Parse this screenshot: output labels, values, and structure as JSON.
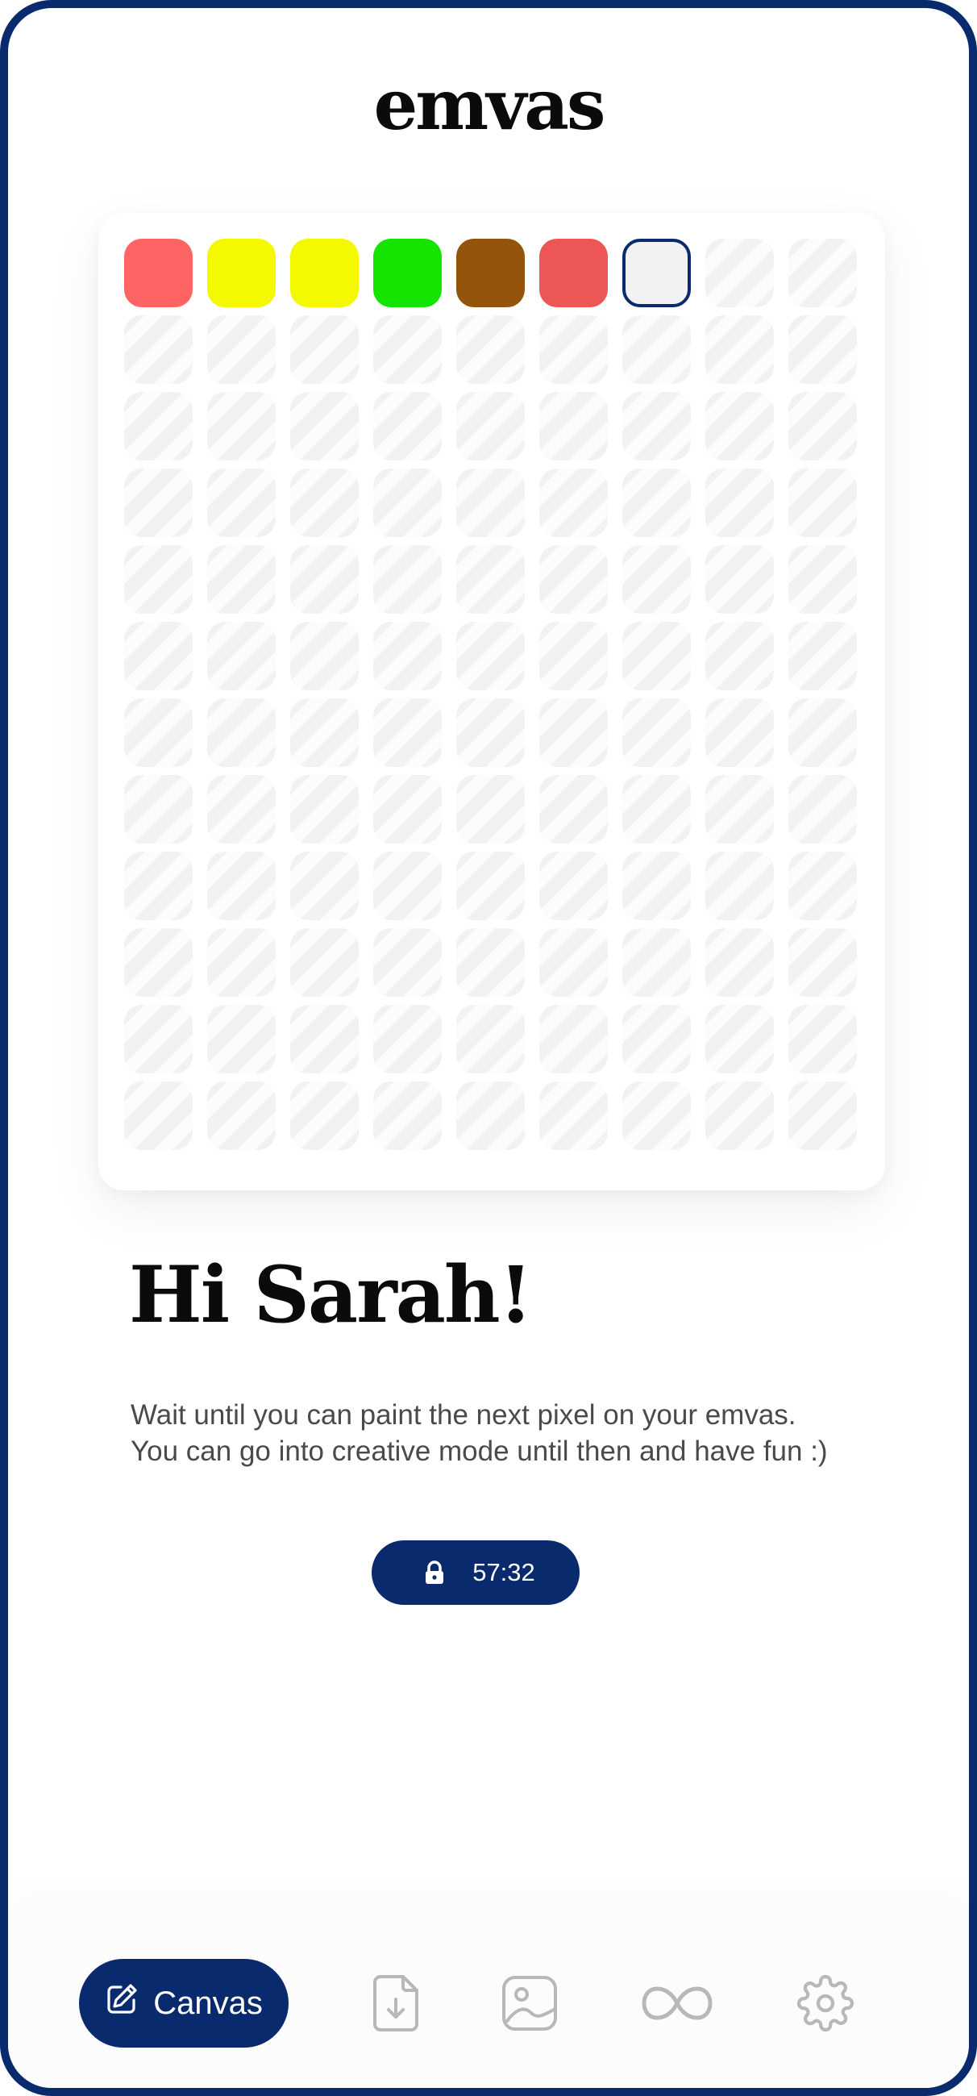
{
  "app": {
    "logo_text": "emvas"
  },
  "canvas": {
    "columns": 9,
    "rows": 12,
    "painted": [
      {
        "index": 0,
        "color": "#ff6464"
      },
      {
        "index": 1,
        "color": "#f4f900"
      },
      {
        "index": 2,
        "color": "#f4f900"
      },
      {
        "index": 3,
        "color": "#14e400"
      },
      {
        "index": 4,
        "color": "#95540c"
      },
      {
        "index": 5,
        "color": "#ec5656"
      }
    ],
    "selected_index": 6
  },
  "greeting": {
    "title": "Hi Sarah!",
    "message_line1": "Wait until you can paint the next pixel on your emvas.",
    "message_line2": "You can go into creative mode until then and have fun :)"
  },
  "timer": {
    "icon": "lock-icon",
    "value": "57:32"
  },
  "nav": {
    "canvas_label": "Canvas",
    "canvas_icon": "edit-icon",
    "items": [
      "download-file-icon",
      "image-icon",
      "infinity-icon",
      "gear-icon"
    ]
  },
  "colors": {
    "brand": "#0a2a6e",
    "empty_cell": "#f2f2f2",
    "nav_icon": "#b8b8b8"
  }
}
